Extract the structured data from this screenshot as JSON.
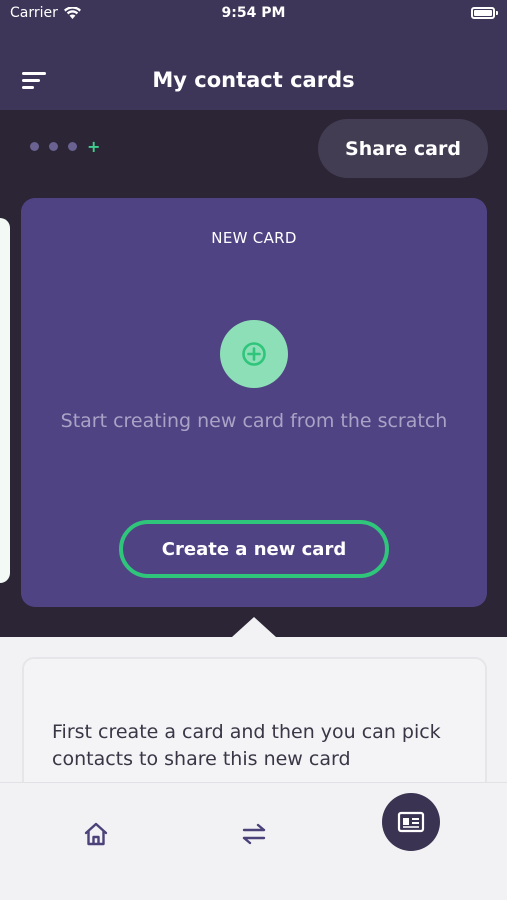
{
  "status_bar": {
    "carrier": "Carrier",
    "time": "9:54 PM"
  },
  "header": {
    "title": "My contact cards",
    "menu_icon": "menu-lines-icon"
  },
  "pager": {
    "dots": 3,
    "add_symbol": "+"
  },
  "share_button": {
    "label": "Share card"
  },
  "new_card": {
    "heading": "NEW CARD",
    "icon": "add-circle-icon",
    "description": "Start creating new card from the scratch",
    "button_label": "Create a new card"
  },
  "info": {
    "text": "First create a card and then you can pick contacts to share this new card"
  },
  "tab_bar": {
    "tabs": [
      {
        "icon": "home-icon",
        "active": false
      },
      {
        "icon": "transfer-arrows-icon",
        "active": false
      },
      {
        "icon": "contact-card-icon",
        "active": true
      }
    ]
  },
  "colors": {
    "header_bg": "#3e3658",
    "band_bg": "#2b2535",
    "card_bg": "#504384",
    "accent_green": "#2fc57a",
    "add_circle_bg": "#8ddfb7",
    "active_tab_bg": "#3b3352"
  }
}
